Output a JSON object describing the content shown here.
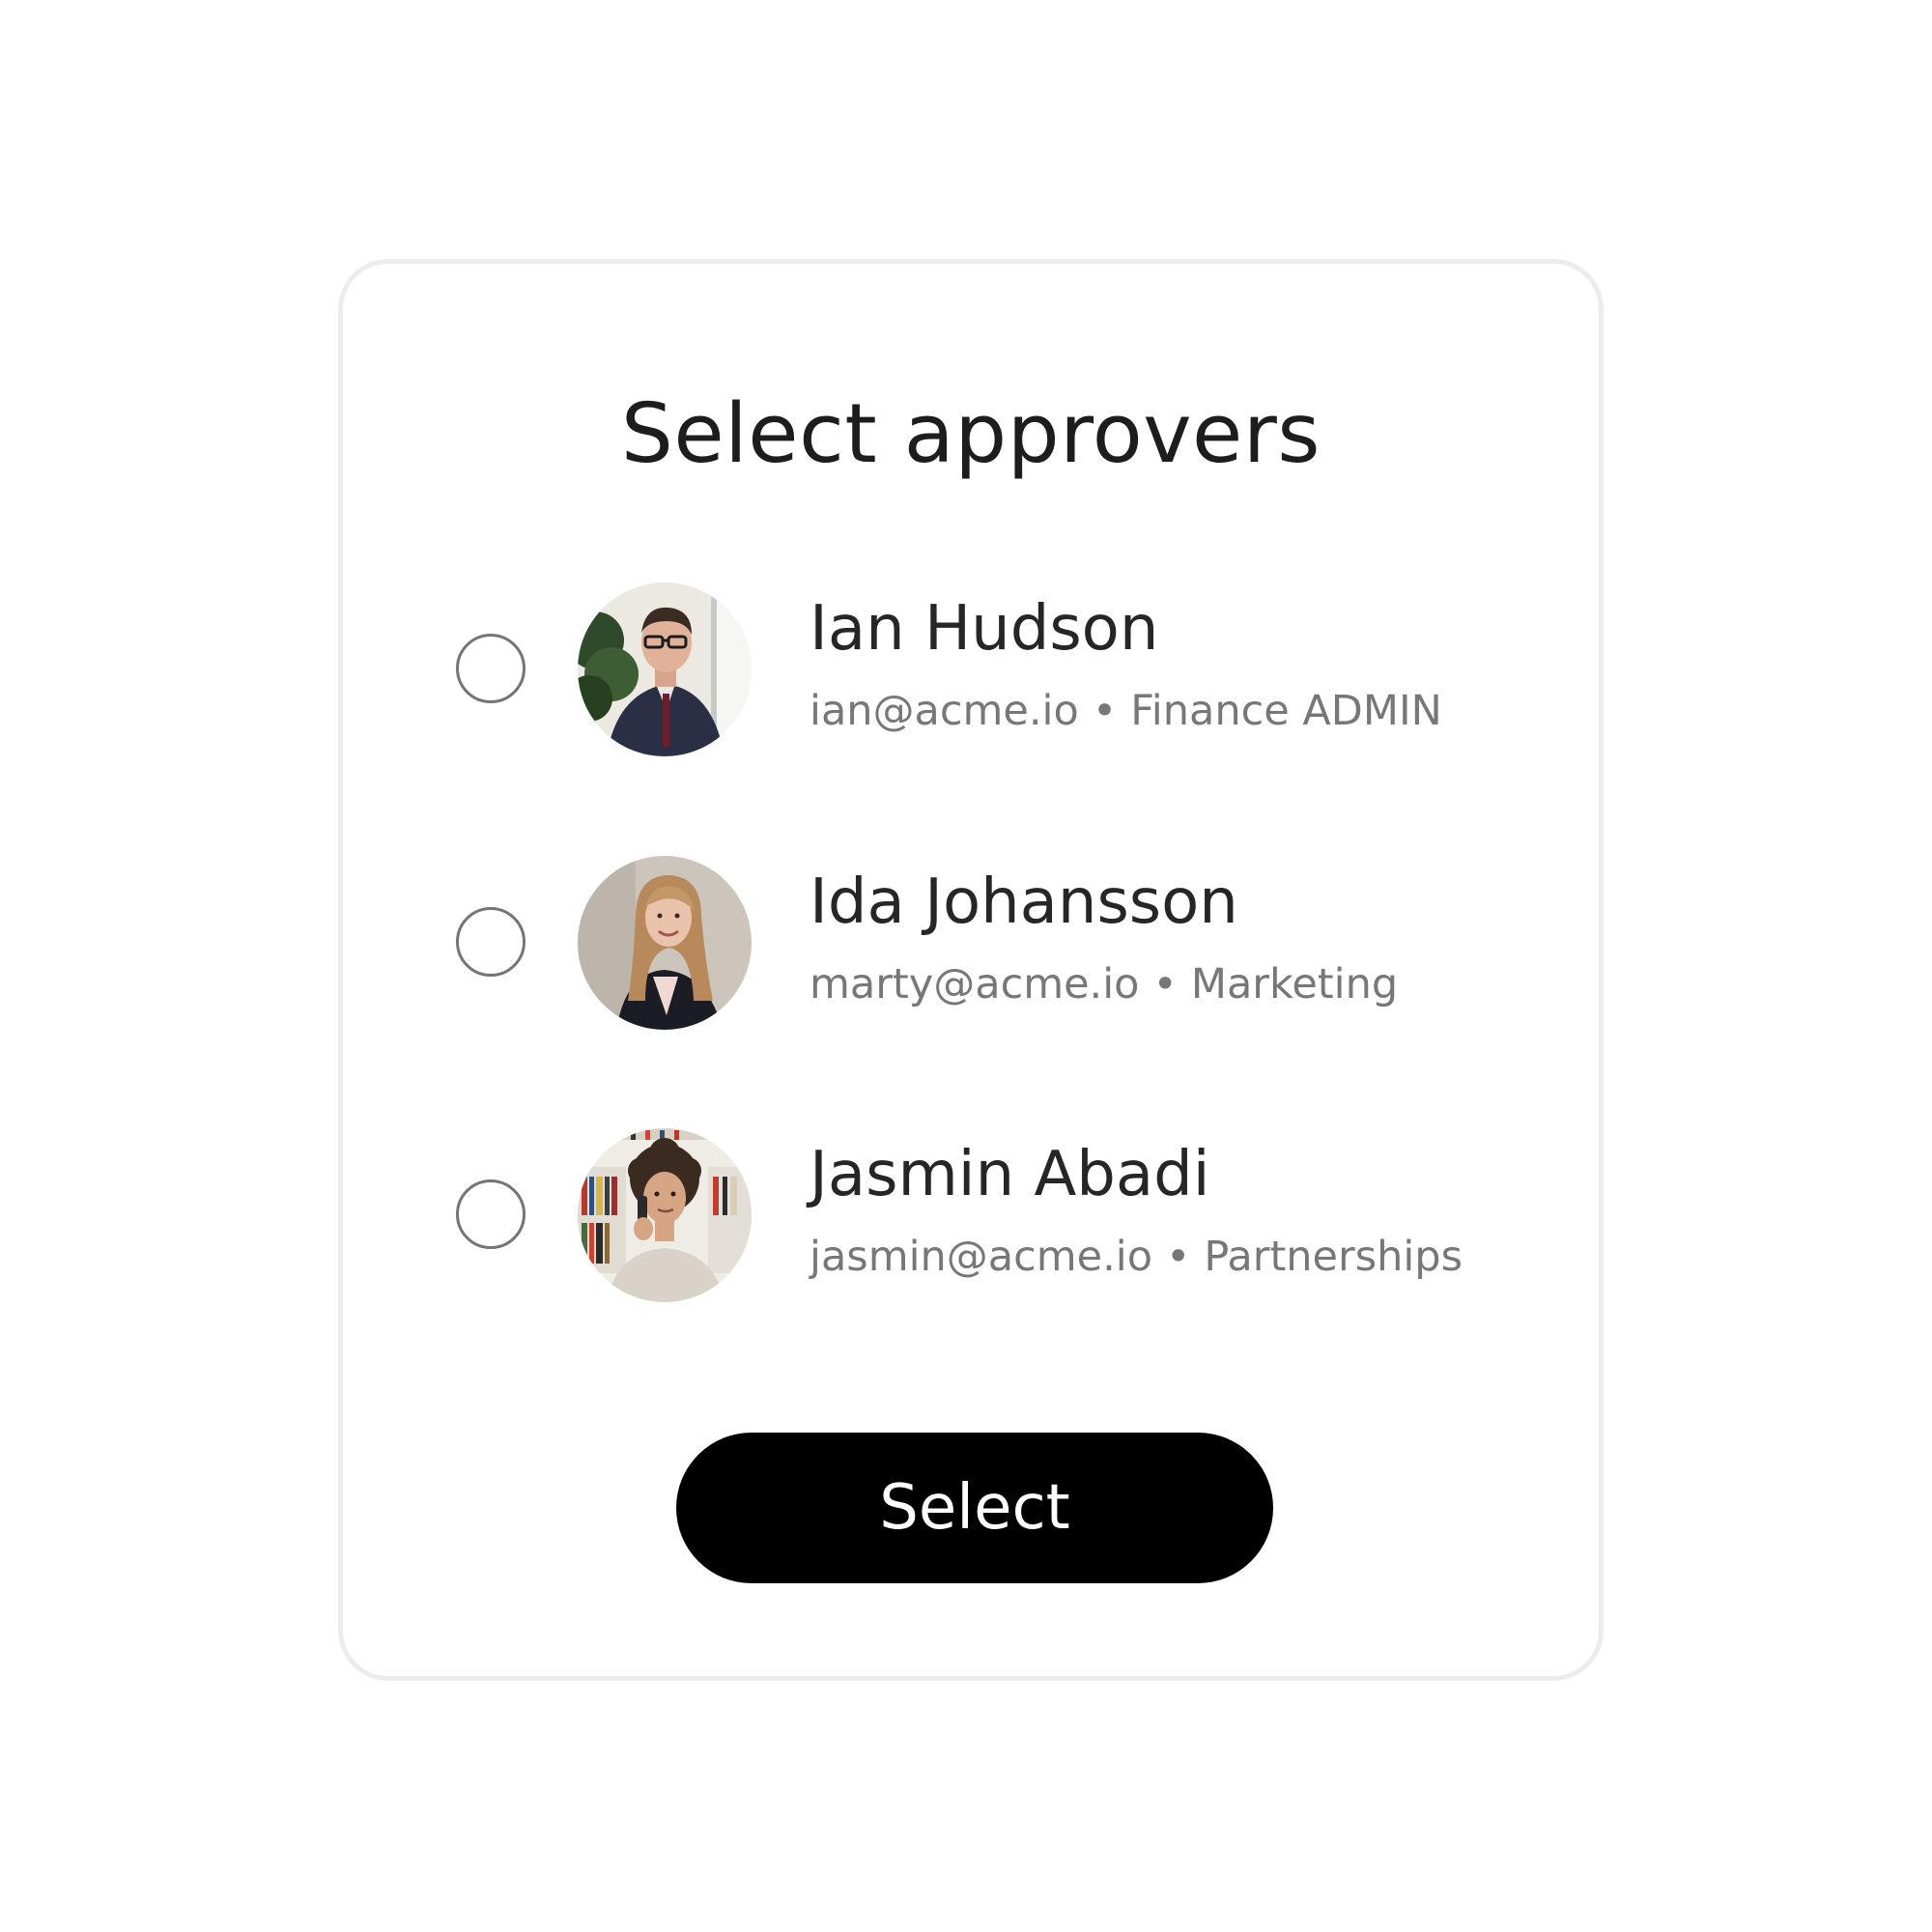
{
  "dialog": {
    "title": "Select approvers",
    "select_label": "Select"
  },
  "separator": "•",
  "approvers": [
    {
      "name": "Ian Hudson",
      "email": "ian@acme.io",
      "role": "Finance ADMIN",
      "avatar_icon": "person-photo-icon",
      "selected": false
    },
    {
      "name": "Ida Johansson",
      "email": "marty@acme.io",
      "role": "Marketing",
      "avatar_icon": "person-photo-icon",
      "selected": false
    },
    {
      "name": "Jasmin Abadi",
      "email": "jasmin@acme.io",
      "role": "Partnerships",
      "avatar_icon": "person-photo-icon",
      "selected": false
    }
  ],
  "colors": {
    "button_background": "#000000",
    "button_text": "#ffffff",
    "card_border": "#ececec",
    "name_text": "#262626",
    "meta_text": "#777777",
    "radio_border": "#757575"
  }
}
